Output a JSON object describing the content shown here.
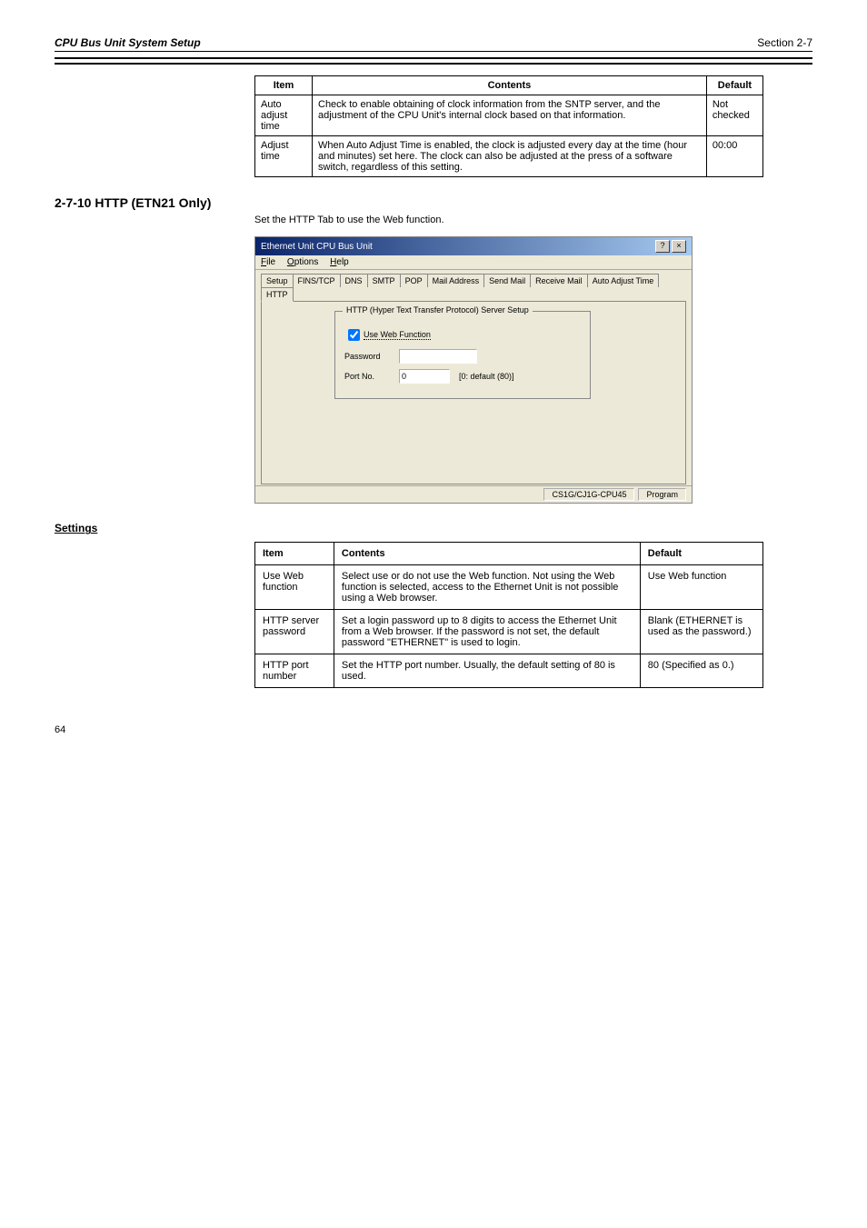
{
  "header": {
    "left": "CPU Bus Unit System Setup",
    "right": "Section 2-7"
  },
  "table1": {
    "headers": [
      "Item",
      "Contents",
      "Default"
    ],
    "rows": [
      [
        "Auto adjust time",
        "Check to enable obtaining of clock information from the SNTP server, and the adjustment of the CPU Unit's internal clock based on that information.",
        "Not checked"
      ],
      [
        "Adjust time",
        "When Auto Adjust Time is enabled, the clock is adjusted every day at the time (hour and minutes) set here. The clock can also be adjusted at the press of a software switch, regardless of this setting.",
        "00:00"
      ]
    ]
  },
  "http_section": {
    "number": "2-7-10",
    "title": "HTTP (ETN21 Only)",
    "description": "Set the HTTP Tab to use the Web function."
  },
  "dialog": {
    "title": "Ethernet Unit CPU Bus Unit",
    "menu": [
      "File",
      "Options",
      "Help"
    ],
    "tabs": [
      "Setup",
      "FINS/TCP",
      "DNS",
      "SMTP",
      "POP",
      "Mail Address",
      "Send Mail",
      "Receive Mail",
      "Auto Adjust Time",
      "HTTP"
    ],
    "active_tab": "HTTP",
    "groupbox_title": "HTTP (Hyper Text Transfer Protocol) Server Setup",
    "use_web_label": "Use Web Function",
    "use_web_checked": true,
    "password_label": "Password",
    "password_value": "",
    "portno_label": "Port No.",
    "portno_value": "0",
    "portno_hint": "[0: default (80)]",
    "status_left": "CS1G/CJ1G-CPU45",
    "status_right": "Program"
  },
  "settings_subtitle": "Settings",
  "table2": {
    "headers": [
      "Item",
      "Contents",
      "Default"
    ],
    "rows": [
      [
        "Use Web function",
        "Select use or do not use the Web function. Not using the Web function is selected, access to the Ethernet Unit is not possible using a Web browser.",
        "Use Web function"
      ],
      [
        "HTTP server password",
        "Set a login password up to 8 digits to access the Ethernet Unit from a Web browser. If the password is not set, the default password \"ETHERNET\" is used to login.",
        "Blank (ETHERNET is used as the password.)"
      ],
      [
        "HTTP port number",
        "Set the HTTP port number. Usually, the default setting of 80 is used.",
        "80 (Specified as 0.)"
      ]
    ]
  },
  "page_number": "64"
}
